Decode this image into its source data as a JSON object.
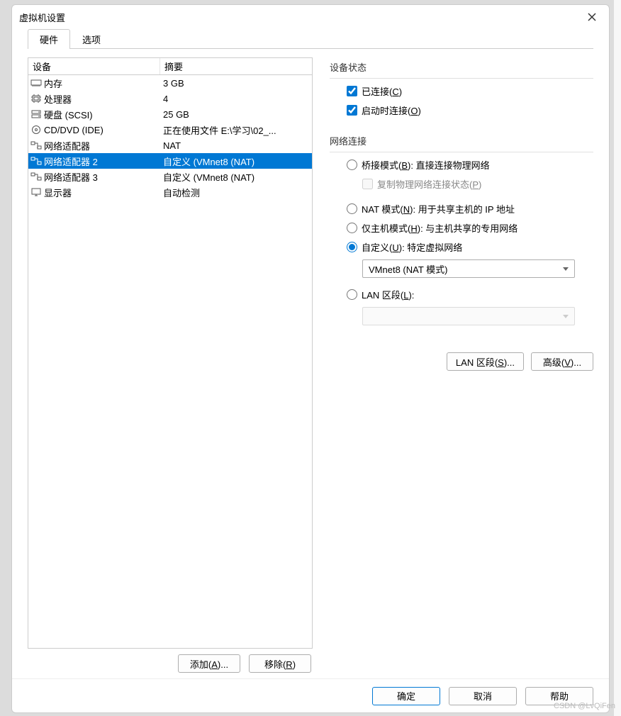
{
  "dialog_title": "虚拟机设置",
  "tabs": {
    "hardware": "硬件",
    "options": "选项"
  },
  "headers": {
    "device": "设备",
    "summary": "摘要"
  },
  "devices": [
    {
      "name": "内存",
      "summary": "3 GB",
      "icon": "memory"
    },
    {
      "name": "处理器",
      "summary": "4",
      "icon": "cpu"
    },
    {
      "name": "硬盘 (SCSI)",
      "summary": "25 GB",
      "icon": "disk"
    },
    {
      "name": "CD/DVD (IDE)",
      "summary": "正在使用文件 E:\\学习\\02_...",
      "icon": "cd"
    },
    {
      "name": "网络适配器",
      "summary": "NAT",
      "icon": "net"
    },
    {
      "name": "网络适配器 2",
      "summary": "自定义 (VMnet8 (NAT)",
      "icon": "net",
      "selected": true
    },
    {
      "name": "网络适配器 3",
      "summary": "自定义 (VMnet8 (NAT)",
      "icon": "net"
    },
    {
      "name": "显示器",
      "summary": "自动检测",
      "icon": "display"
    }
  ],
  "add_btn": "添加(A)...",
  "remove_btn": "移除(R)",
  "status_group": "设备状态",
  "status": {
    "connected": "已连接(C)",
    "connect_on_start": "启动时连接(O)"
  },
  "net_group": "网络连接",
  "net": {
    "bridged": "桥接模式(B): 直接连接物理网络",
    "replicate": "复制物理网络连接状态(P)",
    "nat": "NAT 模式(N): 用于共享主机的 IP 地址",
    "hostonly": "仅主机模式(H): 与主机共享的专用网络",
    "custom": "自定义(U): 特定虚拟网络",
    "custom_select": "VMnet8 (NAT 模式)",
    "lan": "LAN 区段(L):",
    "lan_select": ""
  },
  "net_btns": {
    "lan_segments": "LAN 区段(S)...",
    "advanced": "高级(V)..."
  },
  "dialog_buttons": {
    "ok": "确定",
    "cancel": "取消",
    "help": "帮助"
  },
  "watermark": "CSDN @LvQiFen"
}
